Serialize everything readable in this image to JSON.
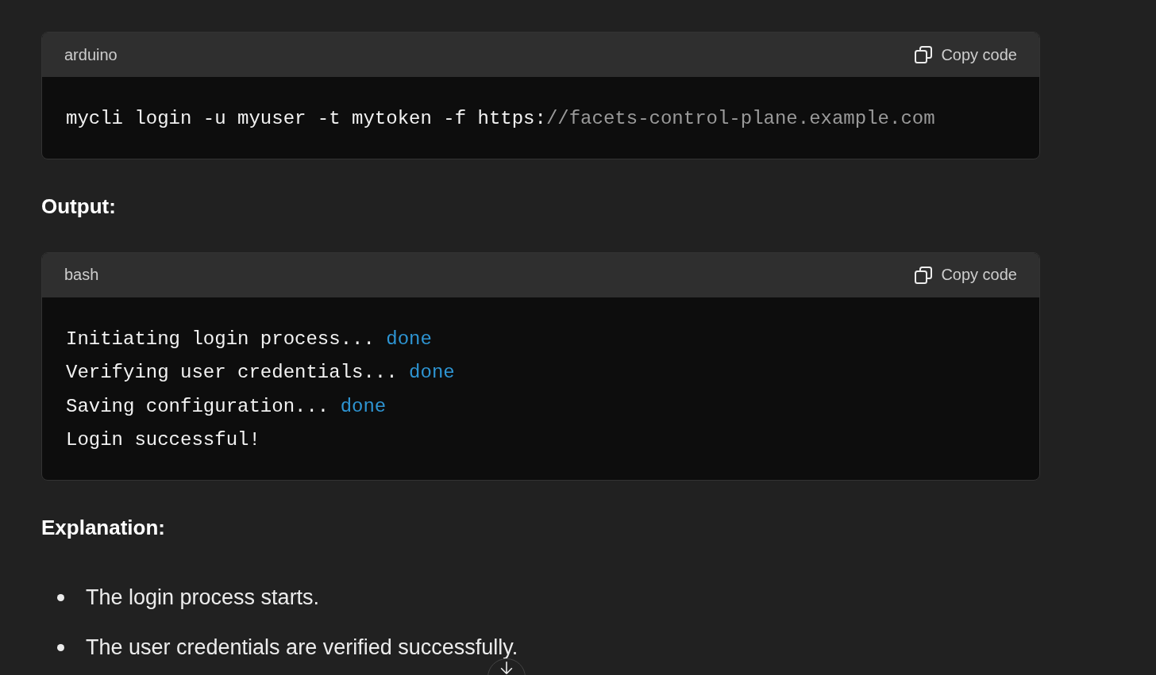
{
  "blocks": [
    {
      "kind": "code",
      "language": "arduino",
      "copy_label": "Copy code",
      "lines": [
        [
          {
            "text": "mycli login -u myuser -t mytoken -f https:",
            "kind": "plain"
          },
          {
            "text": "//facets-control-plane.example.com",
            "kind": "comment"
          }
        ]
      ]
    },
    {
      "kind": "heading",
      "text": "Output:"
    },
    {
      "kind": "code",
      "language": "bash",
      "copy_label": "Copy code",
      "lines": [
        [
          {
            "text": "Initiating login process... ",
            "kind": "plain"
          },
          {
            "text": "done",
            "kind": "keyword"
          }
        ],
        [
          {
            "text": "Verifying user credentials... ",
            "kind": "plain"
          },
          {
            "text": "done",
            "kind": "keyword"
          }
        ],
        [
          {
            "text": "Saving configuration... ",
            "kind": "plain"
          },
          {
            "text": "done",
            "kind": "keyword"
          }
        ],
        [
          {
            "text": "Login successful!",
            "kind": "plain"
          }
        ]
      ]
    },
    {
      "kind": "heading",
      "text": "Explanation:"
    },
    {
      "kind": "bullets",
      "items": [
        "The login process starts.",
        "The user credentials are verified successfully."
      ]
    }
  ],
  "scroll_button": {
    "kind": "down"
  }
}
